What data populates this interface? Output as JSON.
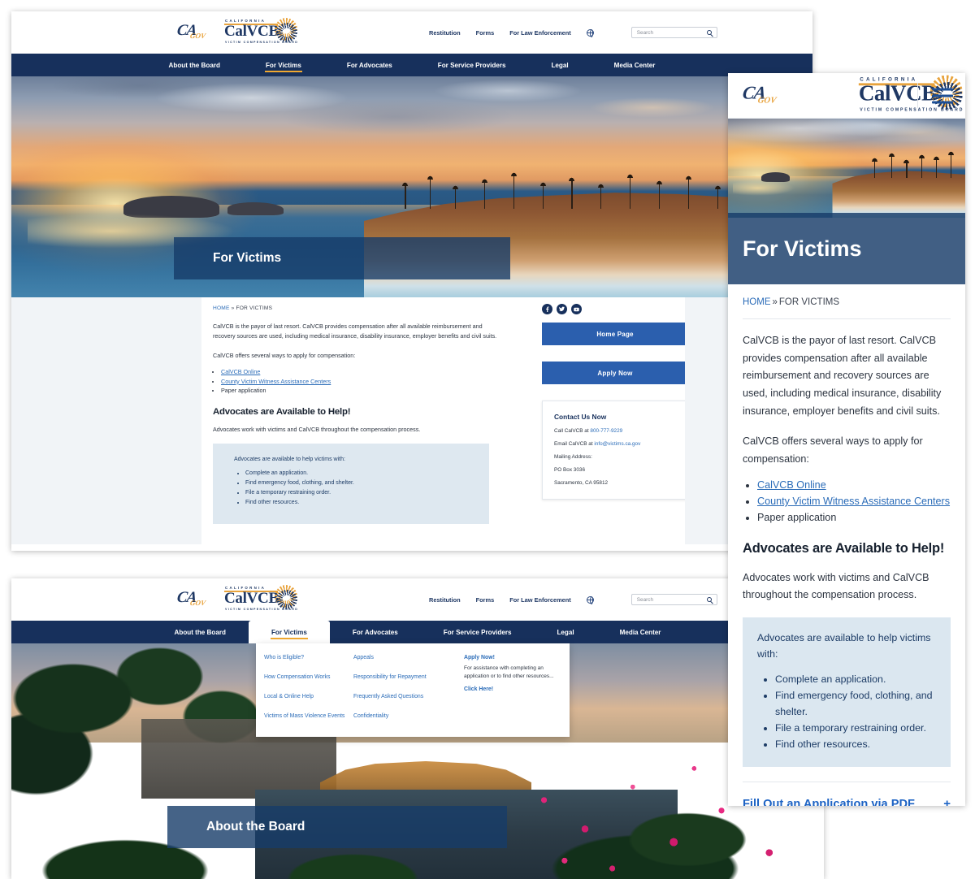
{
  "brand": {
    "ca_gov_initials": "CA",
    "ca_gov_suffix": "GOV",
    "logo_top_text": "CALIFORNIA",
    "logo_main_text": "CalVCB",
    "logo_bottom_text": "VICTIM COMPENSATION BOARD"
  },
  "utility_bar": {
    "links": [
      "Restitution",
      "Forms",
      "For Law Enforcement"
    ],
    "globe_icon": "globe-icon",
    "search_placeholder": "Search",
    "search_value": "",
    "search_icon": "magnifier-icon"
  },
  "main_nav": {
    "items": [
      "About the Board",
      "For Victims",
      "For Advocates",
      "For Service Providers",
      "Legal",
      "Media Center"
    ],
    "active_index": 1,
    "accent_color": "#f0a830",
    "bar_color": "#17305c"
  },
  "desktop_for_victims": {
    "hero_title": "For Victims",
    "breadcrumb": {
      "home": "HOME",
      "separator": "»",
      "current": "FOR VICTIMS"
    },
    "intro_paragraph": "CalVCB is the payor of last resort. CalVCB provides compensation after all available reimbursement and recovery sources are used, including medical insurance, disability insurance, employer benefits and civil suits.",
    "ways_lead": "CalVCB offers several ways to apply for compensation:",
    "ways_list": [
      {
        "label": "CalVCB Online",
        "is_link": true
      },
      {
        "label": "County Victim Witness Assistance Centers",
        "is_link": true
      },
      {
        "label": "Paper application",
        "is_link": false
      }
    ],
    "section_heading": "Advocates are Available to Help!",
    "section_subtext": "Advocates work with victims and CalVCB throughout the compensation process.",
    "callout": {
      "lead": "Advocates are available to help victims with:",
      "items": [
        "Complete an application.",
        "Find emergency food, clothing, and shelter.",
        "File a temporary restraining order.",
        "Find other resources."
      ]
    },
    "sidebar": {
      "social": [
        {
          "name": "facebook-icon",
          "glyph": "f"
        },
        {
          "name": "twitter-icon",
          "glyph": "t"
        },
        {
          "name": "youtube-icon",
          "glyph": "y"
        }
      ],
      "buttons": [
        "Home Page",
        "Apply Now"
      ],
      "contact": {
        "title": "Contact Us Now",
        "phone_label": "Call CalVCB at",
        "phone": "800-777-9229",
        "email_label": "Email CalVCB at",
        "email": "info@victims.ca.gov",
        "mailing_label": "Mailing Address:",
        "po_box": "PO Box 3036",
        "city_state_zip": "Sacramento, CA 95812"
      }
    }
  },
  "mobile_panel": {
    "hamburger_icon": "hamburger-menu-icon",
    "hero_title": "For Victims",
    "breadcrumb": {
      "home": "HOME",
      "separator": "»",
      "current": "FOR VICTIMS"
    },
    "intro_paragraph": "CalVCB is the payor of last resort. CalVCB provides compensation after all available reimbursement and recovery sources are used, including medical insurance, disability insurance, employer benefits and civil suits.",
    "ways_lead": "CalVCB offers several ways to apply for compensation:",
    "ways_list": [
      {
        "label": "CalVCB Online",
        "is_link": true
      },
      {
        "label": "County Victim Witness Assistance Centers",
        "is_link": true
      },
      {
        "label": "Paper application",
        "is_link": false
      }
    ],
    "section_heading": "Advocates are Available to Help!",
    "section_subtext": "Advocates work with victims and CalVCB throughout the compensation process.",
    "callout": {
      "lead": "Advocates are available to help victims with:",
      "items": [
        "Complete an application.",
        "Find emergency food, clothing, and shelter.",
        "File a temporary restraining order.",
        "Find other resources."
      ]
    },
    "accordion": {
      "title": "Fill Out an Application via PDF",
      "toggle": "+"
    }
  },
  "desktop_about_board": {
    "hero_title": "About the Board",
    "open_menu_index": 1,
    "mega_menu": {
      "column_1": [
        "Who is Eligible?",
        "How Compensation Works",
        "Local & Online Help",
        "Victims of Mass Violence Events"
      ],
      "column_2": [
        "Appeals",
        "Responsibility for Repayment",
        "Frequently Asked Questions",
        "Confidentiality"
      ],
      "promo": {
        "title": "Apply Now!",
        "text": "For assistance with completing an application or to find other resources...",
        "link": "Click Here!"
      }
    }
  }
}
